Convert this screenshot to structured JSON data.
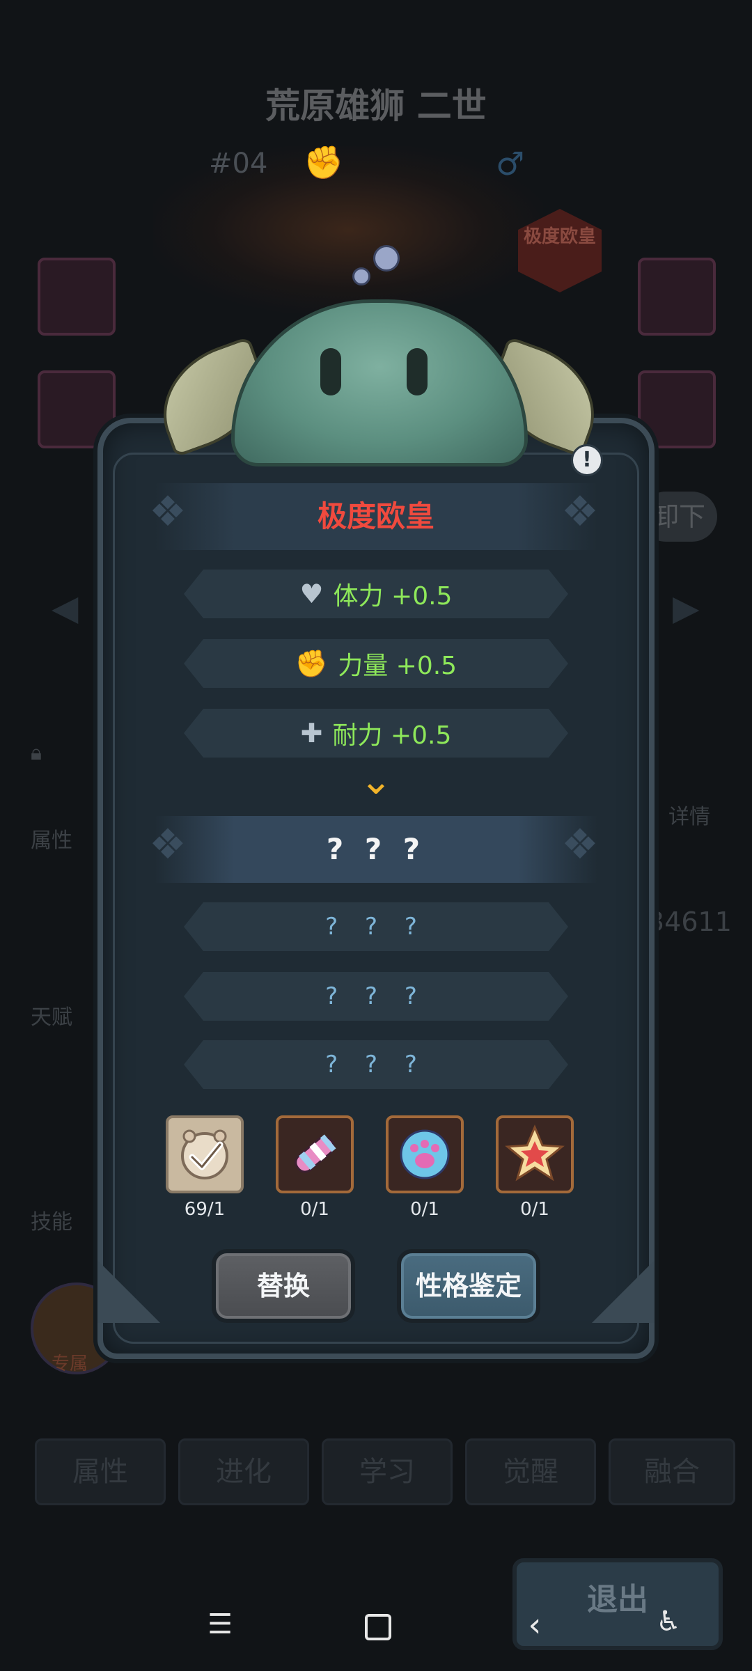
{
  "background": {
    "pet_name": "荒原雄狮 二世",
    "pet_number": "#04",
    "gender_symbol": "♂",
    "badge_text": "极度欧皇",
    "unequip_label": "卸下",
    "detail_label": "详情",
    "side_labels": [
      "属性",
      "天赋",
      "技能"
    ],
    "number_fragment": "34611",
    "avatar_label": "专属",
    "tabs": [
      "属性",
      "进化",
      "学习",
      "觉醒",
      "融合"
    ],
    "exit_label": "退出"
  },
  "dialog": {
    "title": "极度欧皇",
    "title_color": "#f04a3e",
    "stats": [
      {
        "icon": "heart-icon",
        "text": "体力 +0.5"
      },
      {
        "icon": "fist-icon",
        "text": "力量 +0.5"
      },
      {
        "icon": "shield-cross-icon",
        "text": "耐力 +0.5"
      }
    ],
    "stat_color": "#8ee85a",
    "unknown_title": "? ? ?",
    "unknown_rows": [
      "? ? ?",
      "? ? ?",
      "? ? ?"
    ],
    "items": [
      {
        "icon": "clock-check-icon",
        "count": "69/1",
        "selected": true
      },
      {
        "icon": "candy-roll-icon",
        "count": "0/1",
        "selected": false
      },
      {
        "icon": "paw-cookie-icon",
        "count": "0/1",
        "selected": false
      },
      {
        "icon": "star-badge-icon",
        "count": "0/1",
        "selected": false
      }
    ],
    "replace_button": "替换",
    "appraise_button": "性格鉴定"
  },
  "navbar": {
    "menu_icon": "menu-icon",
    "home_icon": "home-icon",
    "back_icon": "back-icon",
    "accessibility_icon": "accessibility-icon"
  }
}
